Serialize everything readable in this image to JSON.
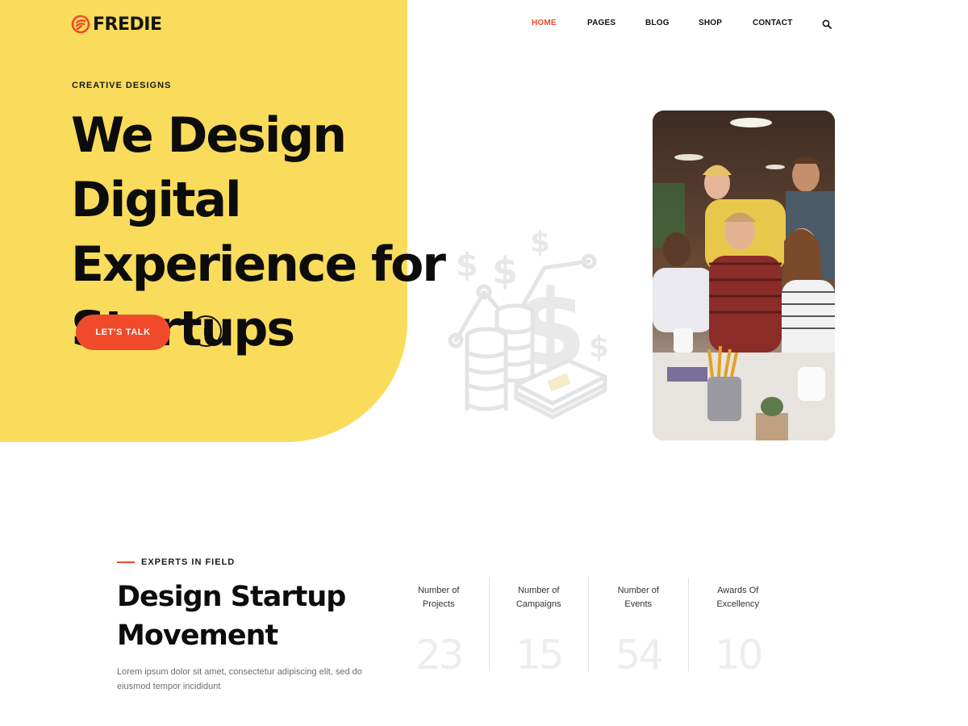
{
  "brand": {
    "name": "FREDIE",
    "logo_icon": "flame-e-icon",
    "accent": "#f04a2a",
    "panel": "#f9dc5c"
  },
  "nav": {
    "items": [
      {
        "label": "HOME",
        "active": true
      },
      {
        "label": "PAGES",
        "active": false
      },
      {
        "label": "BLOG",
        "active": false
      },
      {
        "label": "SHOP",
        "active": false
      },
      {
        "label": "CONTACT",
        "active": false
      }
    ],
    "search_icon": "search-icon"
  },
  "hero": {
    "kicker": "CREATIVE DESIGNS",
    "title": "We Design Digital Experience for Startups",
    "cta_label": "LET'S TALK",
    "play_icon": "play-icon",
    "illustration": "money-coins-icon",
    "photo": "team-meeting-photo"
  },
  "experts": {
    "kicker": "EXPERTS IN FIELD",
    "title": "Design Startup Movement",
    "description": "Lorem ipsum dolor sit amet, consectetur adipiscing elit, sed do eiusmod tempor incididunt"
  },
  "stats": [
    {
      "label_line1": "Number of",
      "label_line2": "Projects",
      "value": "23"
    },
    {
      "label_line1": "Number of",
      "label_line2": "Campaigns",
      "value": "15"
    },
    {
      "label_line1": "Number of",
      "label_line2": "Events",
      "value": "54"
    },
    {
      "label_line1": "Awards Of",
      "label_line2": "Excellency",
      "value": "10"
    }
  ]
}
